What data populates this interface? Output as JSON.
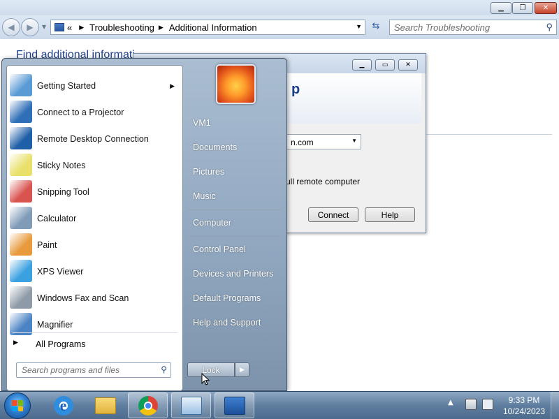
{
  "explorer": {
    "breadcrumb_prefix": "«",
    "breadcrumb": [
      "Troubleshooting",
      "Additional Information"
    ],
    "search_placeholder": "Search Troubleshooting",
    "heading": "Find additional informati"
  },
  "rdp_dialog": {
    "banner_text": "p",
    "computer_value": "n.com",
    "note": "ull remote computer",
    "connect_label": "Connect",
    "help_label": "Help"
  },
  "start_menu": {
    "programs": [
      {
        "label": "Getting Started",
        "icon": "getting-started-icon",
        "has_submenu": true,
        "color": "#5a9bd5"
      },
      {
        "label": "Connect to a Projector",
        "icon": "projector-icon",
        "has_submenu": false,
        "color": "#2f6fb7"
      },
      {
        "label": "Remote Desktop Connection",
        "icon": "remote-desktop-icon",
        "has_submenu": false,
        "color": "#1f5fa8"
      },
      {
        "label": "Sticky Notes",
        "icon": "sticky-notes-icon",
        "has_submenu": false,
        "color": "#e8e06a"
      },
      {
        "label": "Snipping Tool",
        "icon": "scissors-icon",
        "has_submenu": false,
        "color": "#d9534f"
      },
      {
        "label": "Calculator",
        "icon": "calculator-icon",
        "has_submenu": false,
        "color": "#7f9bb8"
      },
      {
        "label": "Paint",
        "icon": "paint-icon",
        "has_submenu": false,
        "color": "#e89a3c"
      },
      {
        "label": "XPS Viewer",
        "icon": "xps-viewer-icon",
        "has_submenu": false,
        "color": "#3aa0e0"
      },
      {
        "label": "Windows Fax and Scan",
        "icon": "fax-icon",
        "has_submenu": false,
        "color": "#8d9aa8"
      },
      {
        "label": "Magnifier",
        "icon": "magnifier-icon",
        "has_submenu": false,
        "color": "#4b84c4"
      }
    ],
    "all_programs": "All Programs",
    "search_placeholder": "Search programs and files",
    "right_items": {
      "user": "VM1",
      "documents": "Documents",
      "pictures": "Pictures",
      "music": "Music",
      "computer": "Computer",
      "control_panel": "Control Panel",
      "devices": "Devices and Printers",
      "default_programs": "Default Programs",
      "help": "Help and Support"
    },
    "lock_label": "Lock"
  },
  "taskbar": {
    "time": "9:33 PM",
    "date": "10/24/2023"
  }
}
